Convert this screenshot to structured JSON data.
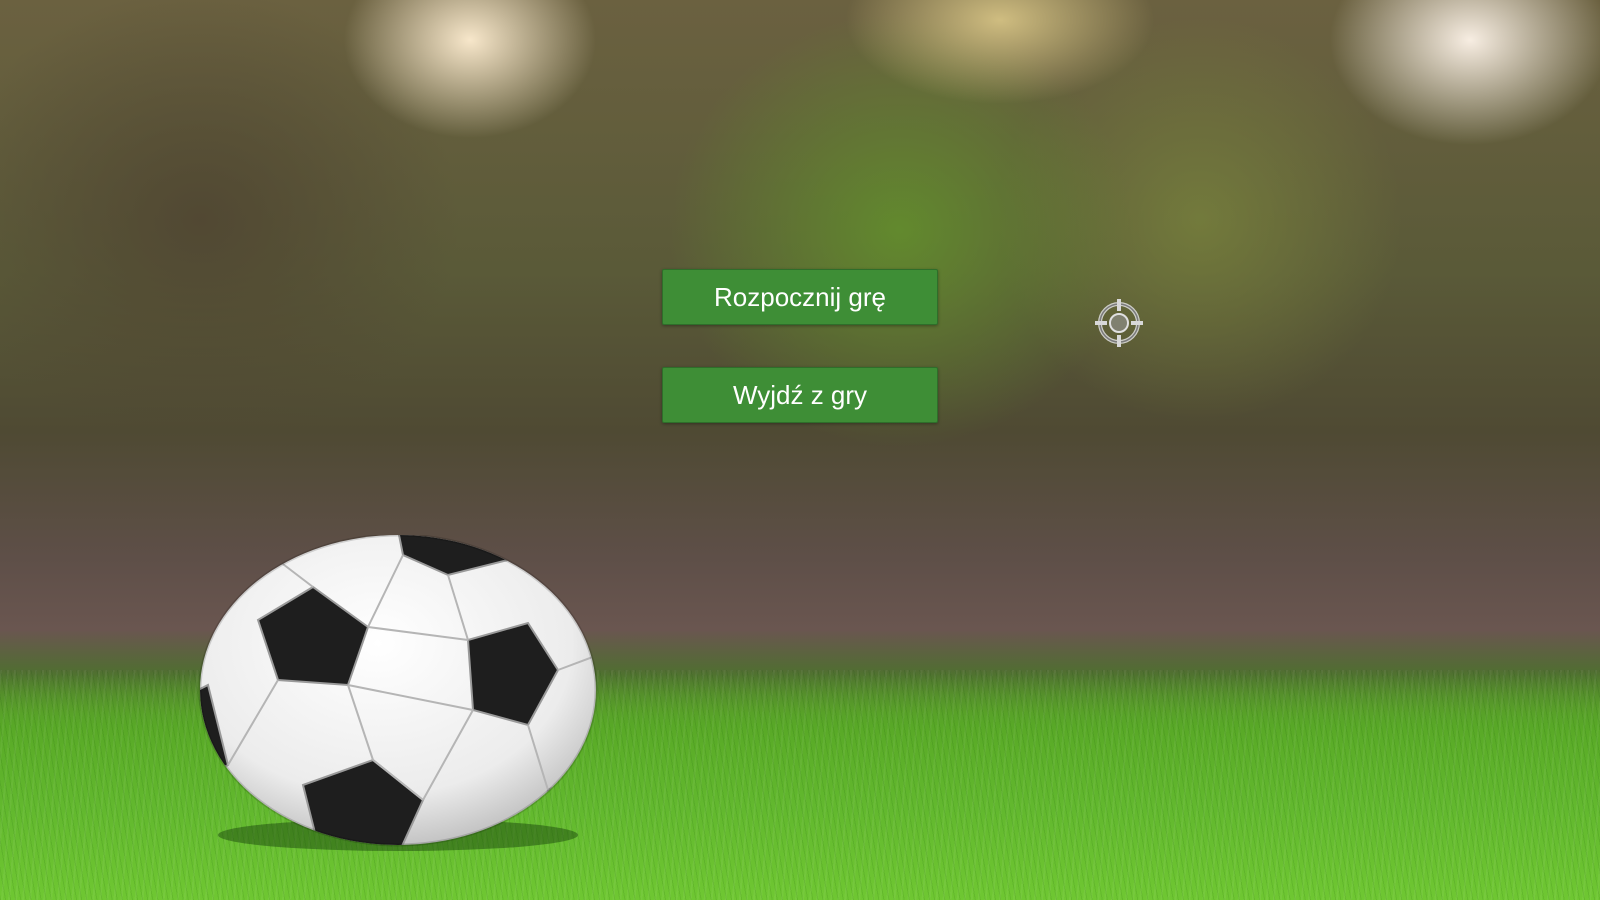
{
  "menu": {
    "start_label": "Rozpocznij grę",
    "exit_label": "Wyjdź z gry"
  },
  "colors": {
    "button_bg": "#3e8e36",
    "button_text": "#ffffff"
  },
  "icons": {
    "cursor": "crosshair-icon",
    "ball": "soccer-ball"
  }
}
